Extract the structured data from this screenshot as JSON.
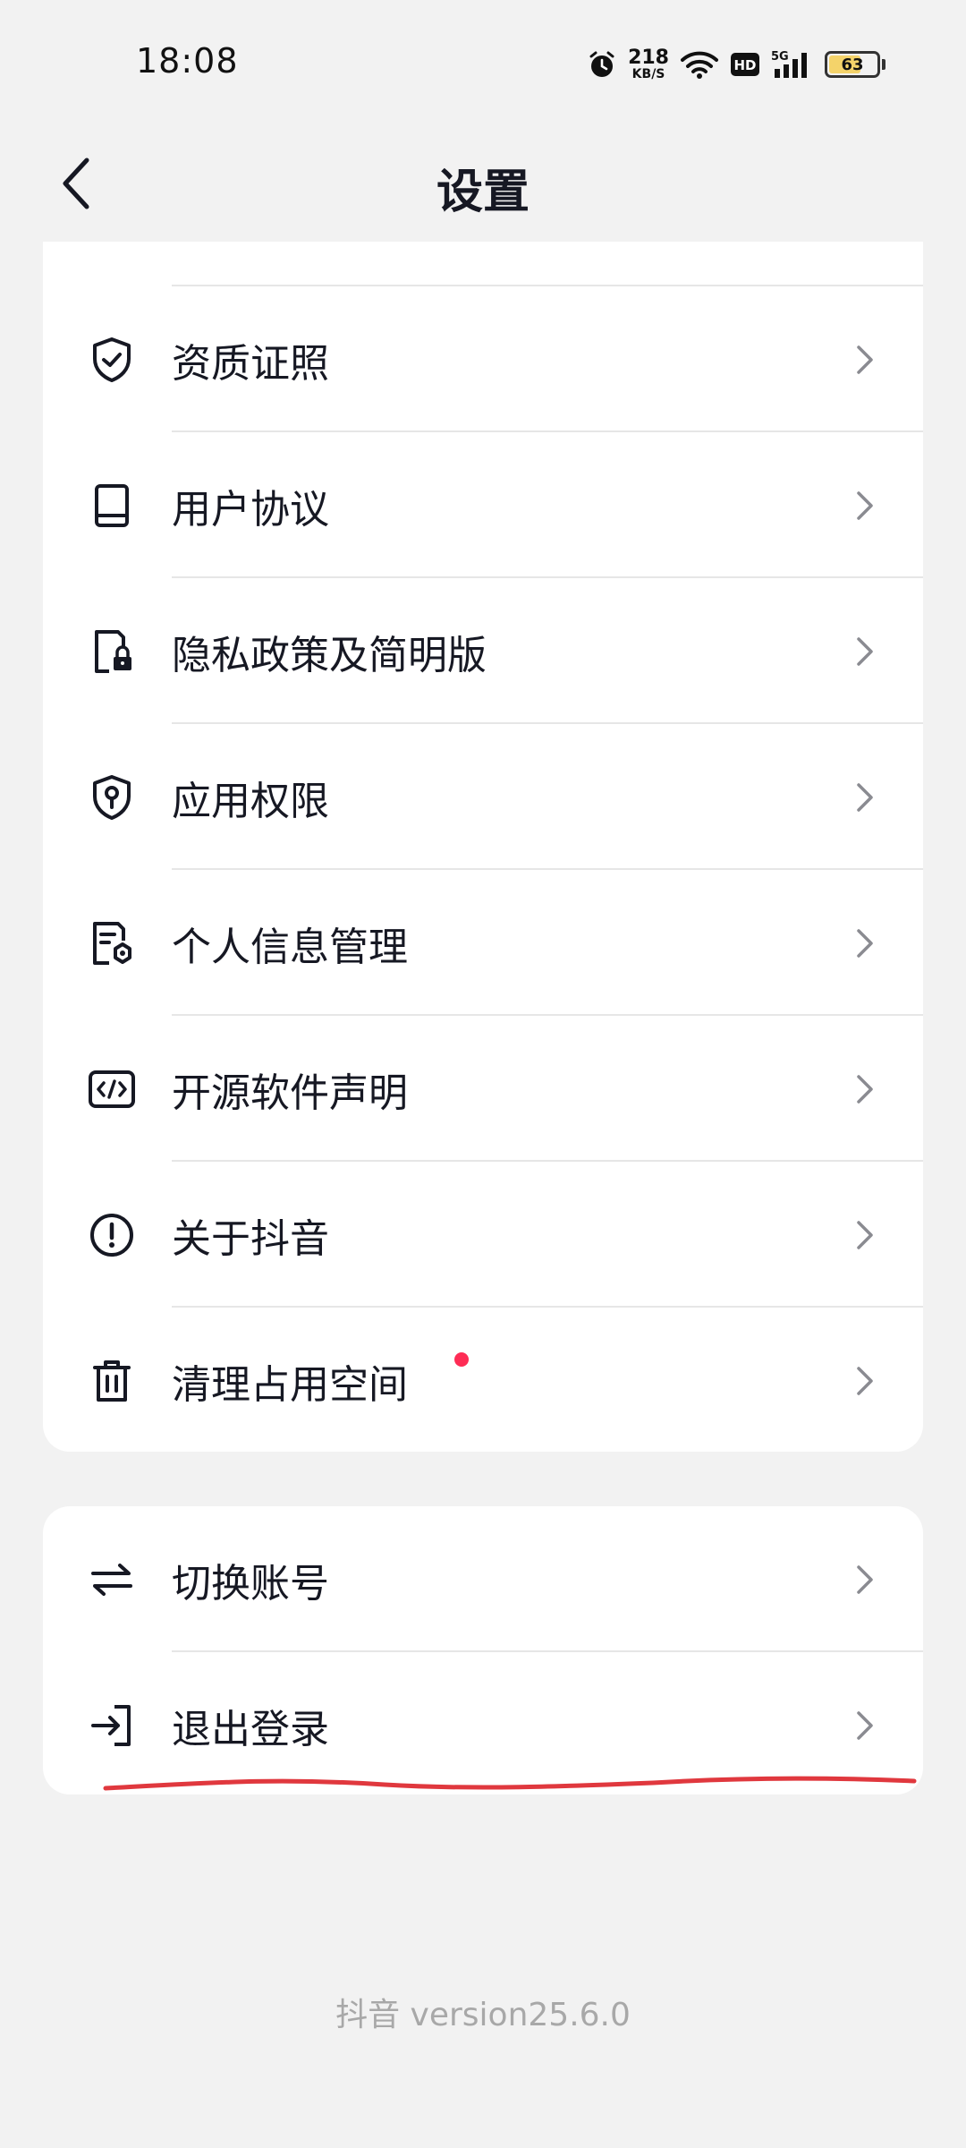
{
  "status_bar": {
    "time": "18:08",
    "net_speed_value": "218",
    "net_speed_unit": "KB/S",
    "hd_label": "HD",
    "signal_label": "5G",
    "battery_level": "63"
  },
  "nav": {
    "title": "设置"
  },
  "settings": {
    "items": [
      {
        "label": "资质证照",
        "icon": "shield-check-icon"
      },
      {
        "label": "用户协议",
        "icon": "book-icon"
      },
      {
        "label": "隐私政策及简明版",
        "icon": "document-lock-icon"
      },
      {
        "label": "应用权限",
        "icon": "shield-key-icon"
      },
      {
        "label": "个人信息管理",
        "icon": "document-gear-icon"
      },
      {
        "label": "开源软件声明",
        "icon": "code-icon"
      },
      {
        "label": "关于抖音",
        "icon": "info-circle-icon"
      },
      {
        "label": "清理占用空间",
        "icon": "trash-icon",
        "badge": "red-dot"
      }
    ]
  },
  "account": {
    "items": [
      {
        "label": "切换账号",
        "icon": "switch-arrows-icon"
      },
      {
        "label": "退出登录",
        "icon": "logout-icon"
      }
    ]
  },
  "footer": {
    "version_text": "抖音 version25.6.0"
  },
  "colors": {
    "background": "#f2f2f2",
    "card": "#ffffff",
    "text": "#161823",
    "badge": "#fe2c55",
    "annotation": "#e0383e",
    "version_text": "#a8a8a8"
  }
}
